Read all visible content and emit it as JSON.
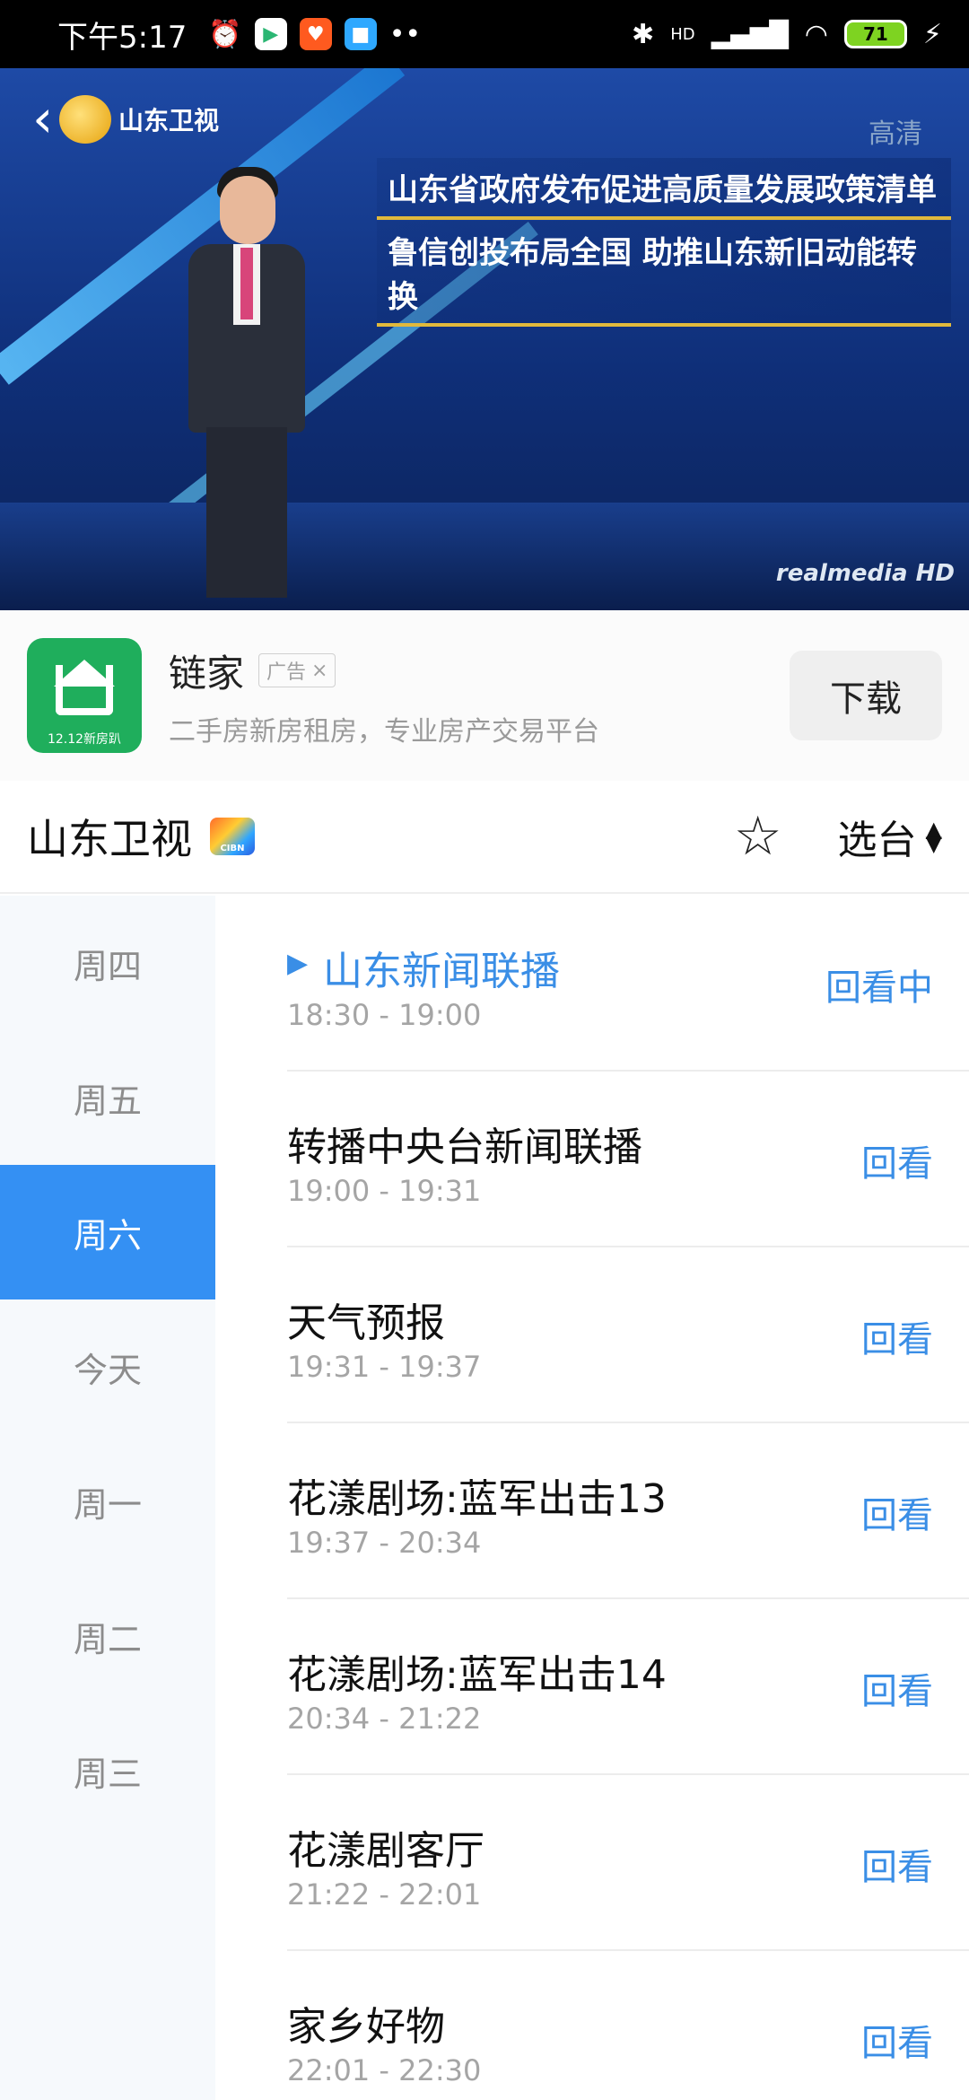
{
  "status_bar": {
    "time": "下午5:17",
    "battery": "71",
    "hd": "HD"
  },
  "video": {
    "logo_text": "山东卫视",
    "quality": "高清",
    "headline_1": "山东省政府发布促进高质量发展政策清单",
    "headline_2": "鲁信创投布局全国 助推山东新旧动能转换",
    "watermark": "realmedia HD"
  },
  "ad": {
    "icon_caption": "12.12新房趴",
    "title": "链家",
    "badge": "广告",
    "description": "二手房新房租房，专业房产交易平台",
    "download_label": "下载"
  },
  "channel": {
    "name": "山东卫视",
    "cibn_label": "CIBN",
    "select_label": "选台"
  },
  "days": [
    {
      "label": "周四"
    },
    {
      "label": "周五"
    },
    {
      "label": "周六"
    },
    {
      "label": "今天"
    },
    {
      "label": "周一"
    },
    {
      "label": "周二"
    },
    {
      "label": "周三"
    }
  ],
  "programs": [
    {
      "title": "山东新闻联播",
      "time": "18:30 - 19:00",
      "action": "回看中"
    },
    {
      "title": "转播中央台新闻联播",
      "time": "19:00 - 19:31",
      "action": "回看"
    },
    {
      "title": "天气预报",
      "time": "19:31 - 19:37",
      "action": "回看"
    },
    {
      "title": "花漾剧场:蓝军出击13",
      "time": "19:37 - 20:34",
      "action": "回看"
    },
    {
      "title": "花漾剧场:蓝军出击14",
      "time": "20:34 - 21:22",
      "action": "回看"
    },
    {
      "title": "花漾剧客厅",
      "time": "21:22 - 22:01",
      "action": "回看"
    },
    {
      "title": "家乡好物",
      "time": "22:01 - 22:30",
      "action": "回看"
    }
  ],
  "colors": {
    "accent": "#3a8ee6",
    "active_day_bg": "#3490f3",
    "ad_icon_bg": "#1fae5c"
  }
}
